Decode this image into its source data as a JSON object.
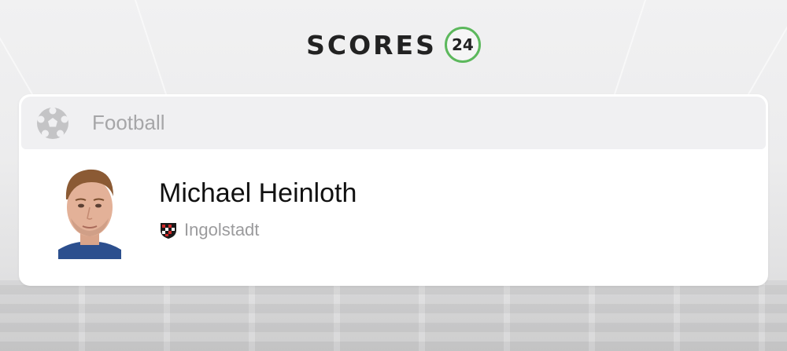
{
  "brand": {
    "logo_text": "SCORES",
    "logo_number": "24",
    "accent_color": "#5cb85c"
  },
  "search_result": {
    "sport": {
      "label": "Football",
      "icon": "soccer-ball-icon"
    },
    "player": {
      "name": "Michael Heinloth",
      "team": "Ingolstadt",
      "team_icon": "team-crest-icon",
      "avatar": "player-photo"
    }
  }
}
